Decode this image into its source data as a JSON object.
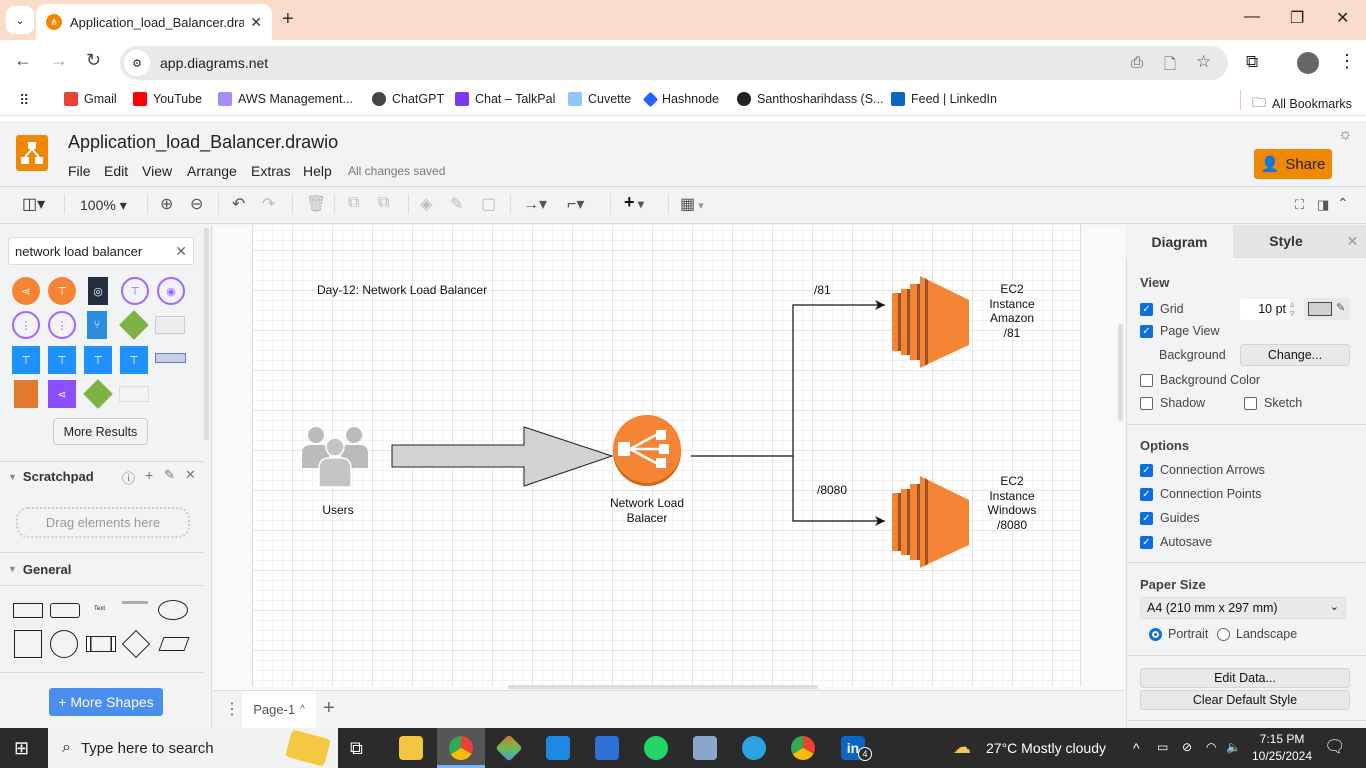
{
  "browser": {
    "tab_title": "Application_load_Balancer.drawio",
    "url": "app.diagrams.net",
    "bookmarks": [
      {
        "label": "Gmail",
        "color": "#ea4335"
      },
      {
        "label": "YouTube",
        "color": "#ff0000"
      },
      {
        "label": "AWS Management...",
        "color": "#8b5cf6"
      },
      {
        "label": "ChatGPT",
        "color": "#444444"
      },
      {
        "label": "Chat – TalkPal",
        "color": "#7c3aed"
      },
      {
        "label": "Cuvette",
        "color": "#3b82f6"
      },
      {
        "label": "Hashnode",
        "color": "#2962ff"
      },
      {
        "label": "Santhosharihdass (S...",
        "color": "#222222"
      },
      {
        "label": "Feed | LinkedIn",
        "color": "#0a66c2"
      }
    ],
    "all_bookmarks": "All Bookmarks"
  },
  "app": {
    "doc_title": "Application_load_Balancer.drawio",
    "menus": [
      "File",
      "Edit",
      "View",
      "Arrange",
      "Extras",
      "Help"
    ],
    "save_status": "All changes saved",
    "share_label": "Share",
    "zoom": "100%",
    "accent": "#f08705"
  },
  "left_panel": {
    "search_value": "network load balancer",
    "more_results": "More Results",
    "scratchpad": "Scratchpad",
    "drag_hint": "Drag elements here",
    "general": "General",
    "more_shapes": "+ More Shapes"
  },
  "diagram": {
    "title": "Day-12: Network Load Balancer",
    "users_label": "Users",
    "nlb_label_1": "Network Load",
    "nlb_label_2": "Balacer",
    "edge1_label": "/81",
    "edge2_label": "/8080",
    "ec2_1": [
      "EC2",
      "Instance",
      "Amazon",
      "/81"
    ],
    "ec2_2": [
      "EC2",
      "Instance",
      "Windows",
      "/8080"
    ]
  },
  "pages": {
    "current": "Page-1"
  },
  "right_panel": {
    "tabs": [
      "Diagram",
      "Style"
    ],
    "view_heading": "View",
    "grid": {
      "label": "Grid",
      "checked": true,
      "size": "10 pt"
    },
    "page_view": {
      "label": "Page View",
      "checked": true
    },
    "background_label": "Background",
    "change_btn": "Change...",
    "bg_color": {
      "label": "Background Color",
      "checked": false
    },
    "shadow": {
      "label": "Shadow",
      "checked": false
    },
    "sketch": {
      "label": "Sketch",
      "checked": false
    },
    "options_heading": "Options",
    "options": [
      {
        "label": "Connection Arrows",
        "checked": true
      },
      {
        "label": "Connection Points",
        "checked": true
      },
      {
        "label": "Guides",
        "checked": true
      },
      {
        "label": "Autosave",
        "checked": true
      }
    ],
    "paper_heading": "Paper Size",
    "paper_size": "A4 (210 mm x 297 mm)",
    "portrait": "Portrait",
    "landscape": "Landscape",
    "orientation": "Portrait",
    "edit_data": "Edit Data...",
    "clear_style": "Clear Default Style"
  },
  "taskbar": {
    "search_placeholder": "Type here to search",
    "weather": "27°C  Mostly cloudy",
    "time": "7:15 PM",
    "date": "10/25/2024",
    "linkedin_badge": "4"
  }
}
